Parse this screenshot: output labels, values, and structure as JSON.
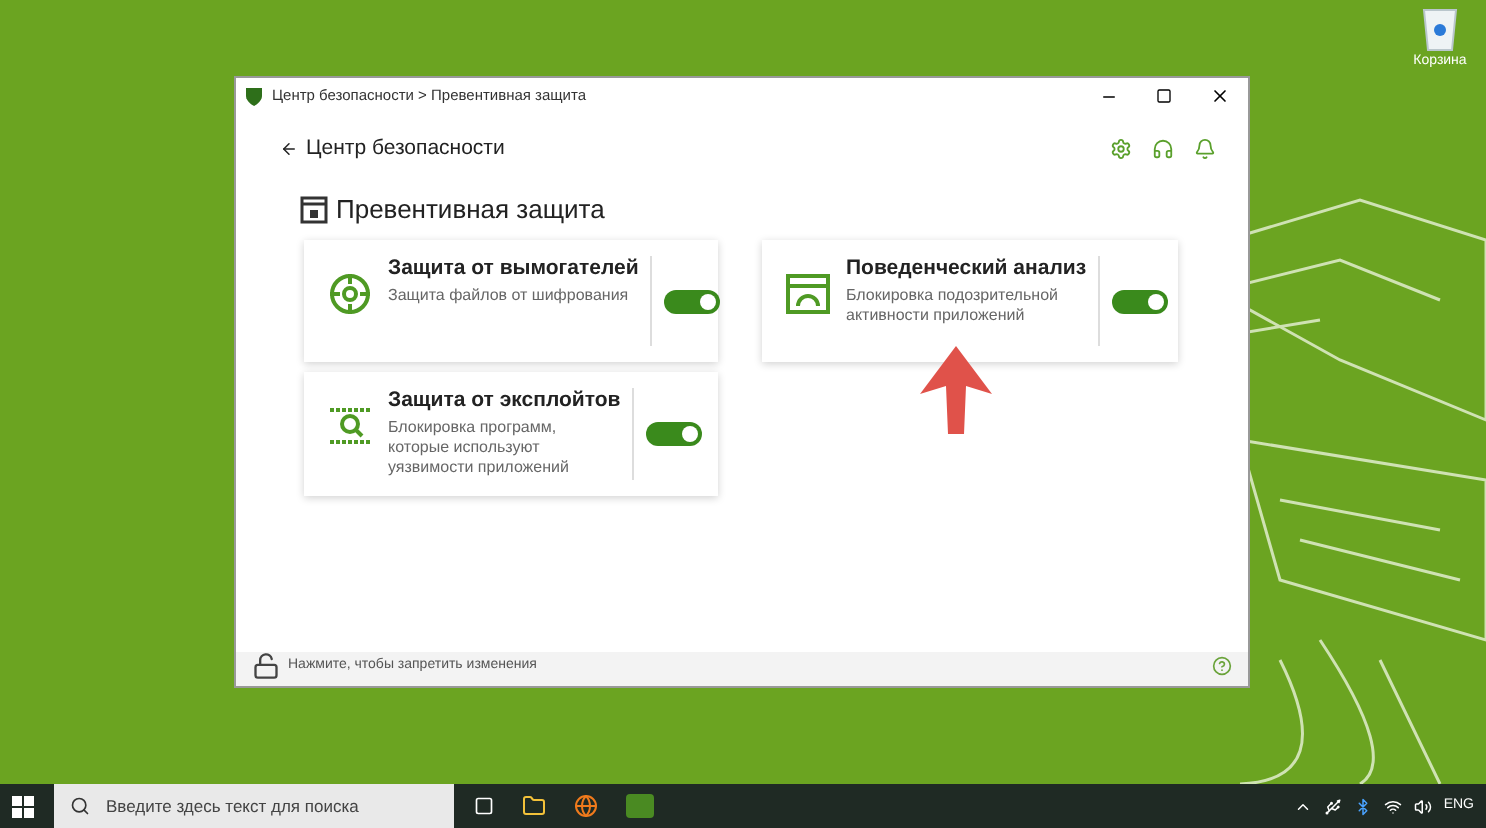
{
  "desktop": {
    "recycle_bin": "Корзина"
  },
  "window": {
    "title": "Центр безопасности > Превентивная защита",
    "back": "Центр безопасности",
    "heading": "Превентивная защита",
    "cards": [
      {
        "kind": "ransomware",
        "title": "Защита от вымогателей",
        "description": "Защита файлов от шифрования",
        "on": true
      },
      {
        "kind": "behavior",
        "title": "Поведенческий анализ",
        "description": "Блокировка подозрительной активности приложений",
        "on": true
      },
      {
        "kind": "exploit",
        "title": "Защита от эксплойтов",
        "description": "Блокировка программ, которые используют уязвимости приложений",
        "on": true
      }
    ],
    "footer": "Нажмите, чтобы запретить изменения"
  },
  "taskbar": {
    "search_placeholder": "Введите здесь текст для поиска",
    "language": "ENG"
  }
}
